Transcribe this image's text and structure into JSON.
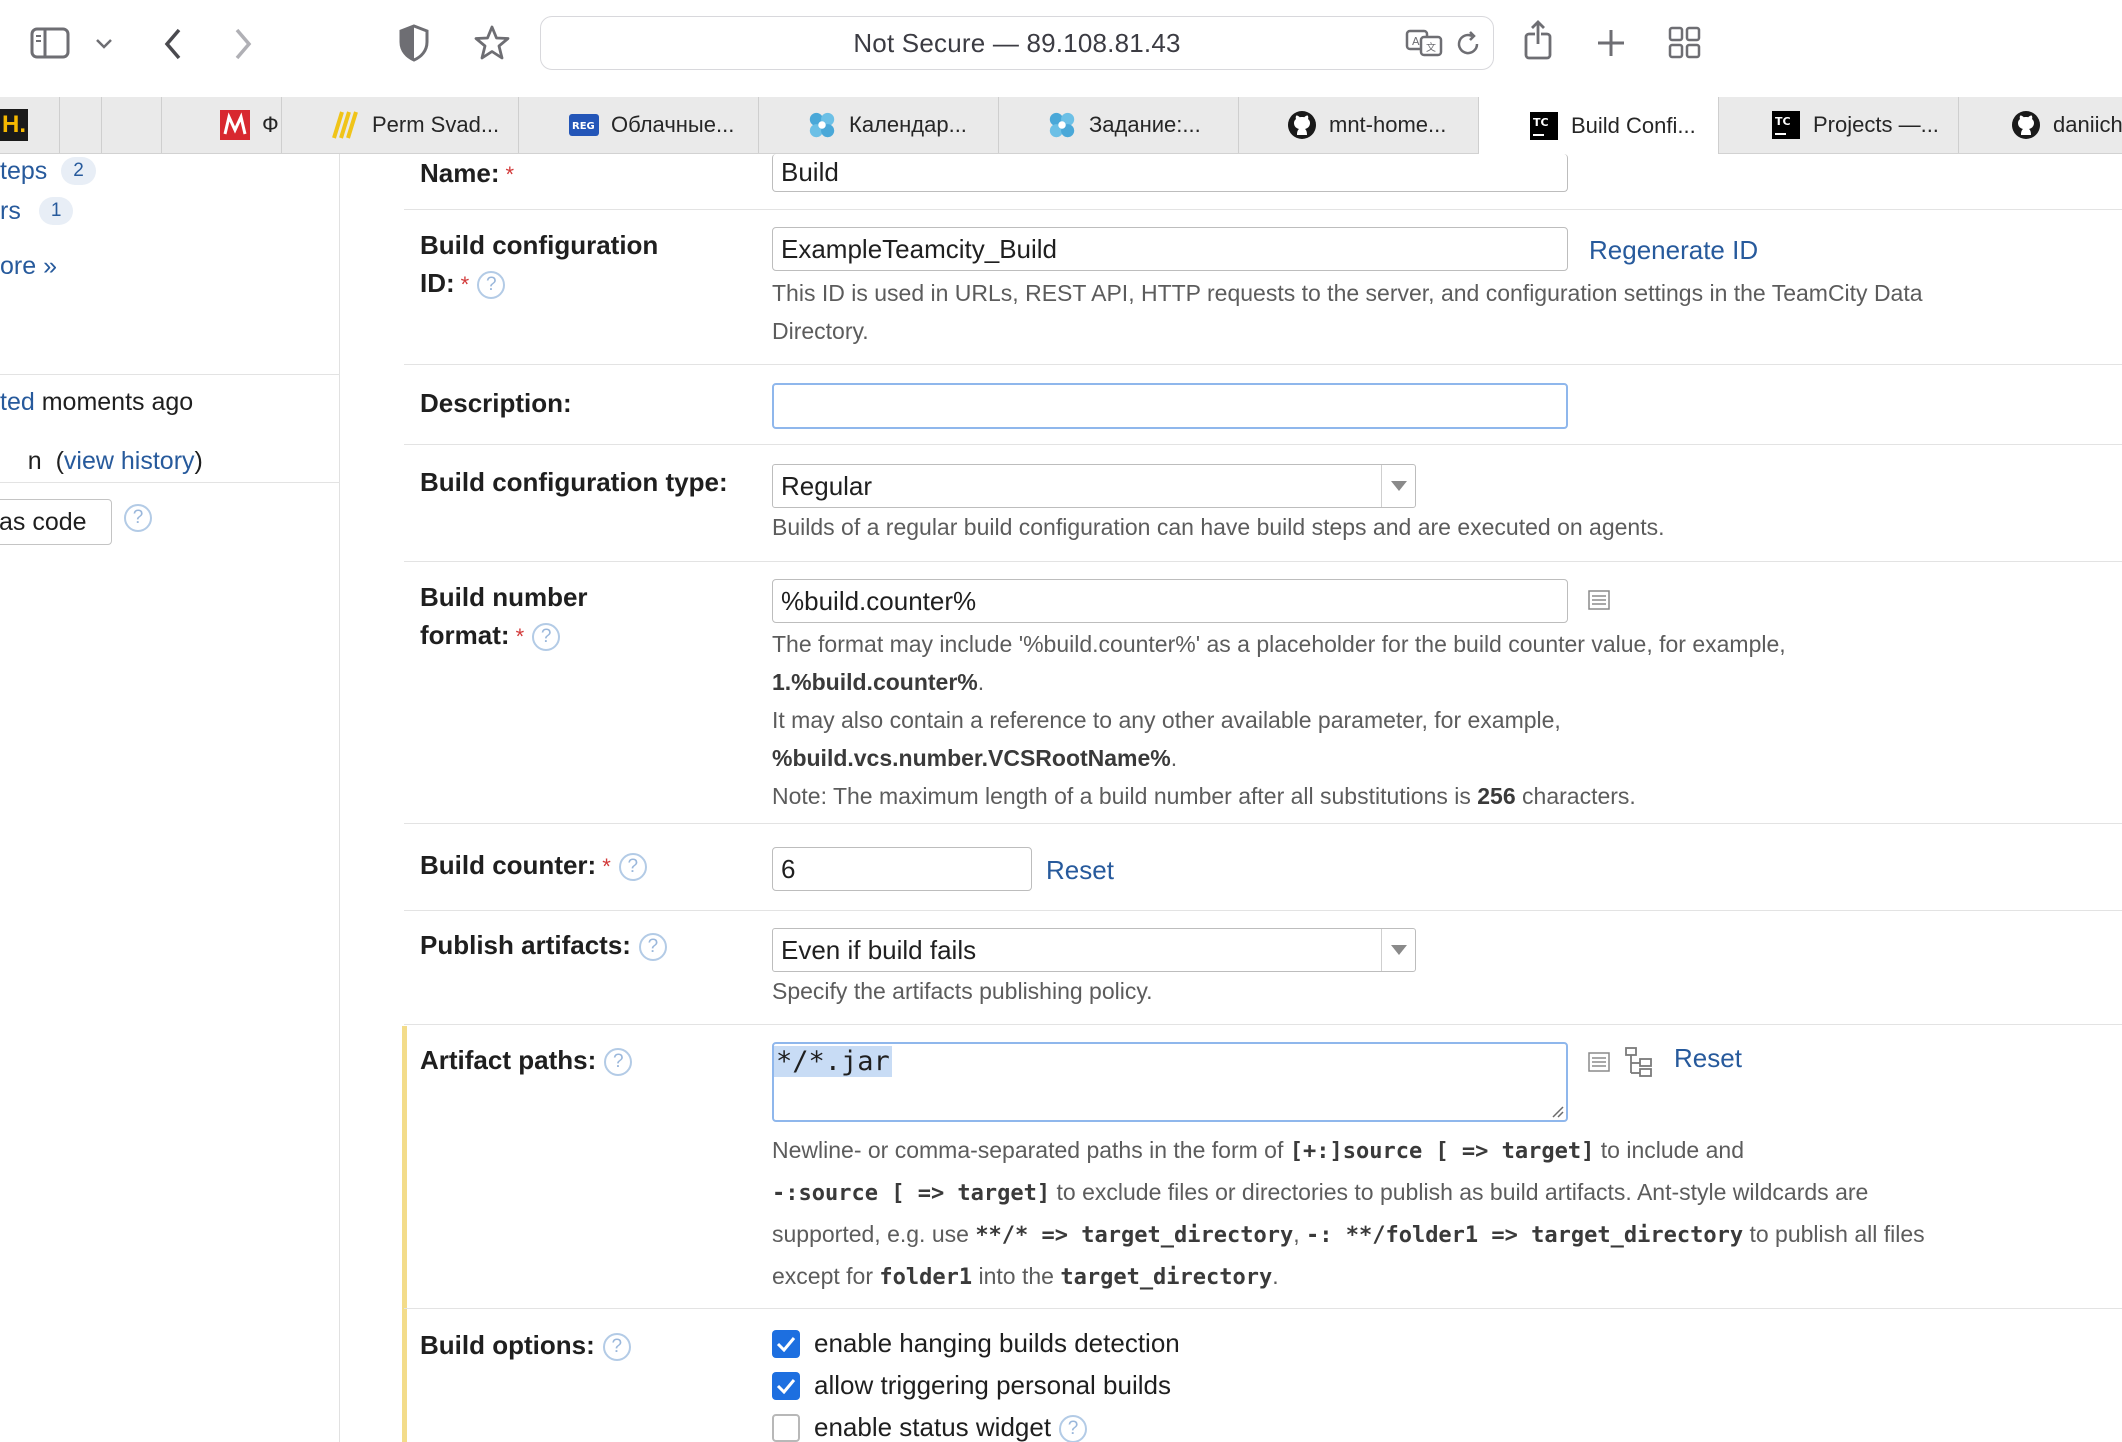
{
  "browser": {
    "address": "Not Secure — 89.108.81.43",
    "tabs": [
      {
        "label": "Ф",
        "icon": "red-m-icon"
      },
      {
        "label": "Perm Svad...",
        "icon": "yellow-lines-icon"
      },
      {
        "label": "Облачные...",
        "icon": "reg-icon"
      },
      {
        "label": "Календар...",
        "icon": "teams-icon"
      },
      {
        "label": "Задание:...",
        "icon": "teams-icon"
      },
      {
        "label": "mnt-home...",
        "icon": "github-icon"
      },
      {
        "label": "Build Confi...",
        "icon": "teamcity-icon"
      },
      {
        "label": "Projects —...",
        "icon": "teamcity-icon"
      },
      {
        "label": "daniich",
        "icon": "github-icon"
      }
    ],
    "first_tab_glyph": "H."
  },
  "sidebar": {
    "steps_label": "teps",
    "steps_count": "2",
    "triggers_label": "rs",
    "triggers_count": "1",
    "more_link": "ore »",
    "edited_link": "ted",
    "edited_text": " moments ago",
    "history_prefix": "n  (",
    "history_link": "view history",
    "history_suffix": ")",
    "as_code_button": "as code"
  },
  "form": {
    "name": {
      "label": "Name:",
      "value": "Build"
    },
    "config_id": {
      "label_line1": "Build configuration",
      "label_line2": "ID:",
      "value": "ExampleTeamcity_Build",
      "regenerate": "Regenerate ID",
      "note_line1": "This ID is used in URLs, REST API, HTTP requests to the server, and configuration settings in the TeamCity Data",
      "note_line2": "Directory."
    },
    "description": {
      "label": "Description:",
      "value": ""
    },
    "config_type": {
      "label": "Build configuration type:",
      "value": "Regular",
      "note": "Builds of a regular build configuration can have build steps and are executed on agents."
    },
    "number_format": {
      "label_line1": "Build number",
      "label_line2": "format:",
      "value": "%build.counter%",
      "note1": "The format may include '%build.counter%' as a placeholder for the build counter value, for example,",
      "note2_bold": "1.%build.counter%",
      "note2_rest": ".",
      "note3": "It may also contain a reference to any other available parameter, for example,",
      "note4_bold": "%build.vcs.number.VCSRootName%",
      "note4_rest": ".",
      "note5_pre": "Note: The maximum length of a build number after all substitutions is ",
      "note5_bold": "256",
      "note5_post": " characters."
    },
    "counter": {
      "label": "Build counter:",
      "value": "6",
      "reset": "Reset"
    },
    "publish": {
      "label": "Publish artifacts:",
      "value": "Even if build fails",
      "note": "Specify the artifacts publishing policy."
    },
    "artifacts": {
      "label": "Artifact paths:",
      "value": "*/*.jar",
      "reset": "Reset",
      "n1a": "Newline- or comma-separated paths in the form of ",
      "n1b": "[+:]source [ => target]",
      "n1c": " to include and",
      "n2a": "-:source [ => target]",
      "n2b": " to exclude files or directories to publish as build artifacts. Ant-style wildcards are",
      "n3a": "supported, e.g. use ",
      "n3b": "**/* => target_directory",
      "n3c": ", ",
      "n3d": "-: **/folder1 => target_directory",
      "n3e": " to publish all files",
      "n4a": "except for ",
      "n4b": "folder1",
      "n4c": " into the ",
      "n4d": "target_directory",
      "n4e": "."
    },
    "options": {
      "label": "Build options:",
      "items": [
        {
          "label": "enable hanging builds detection",
          "checked": true
        },
        {
          "label": "allow triggering personal builds",
          "checked": true
        },
        {
          "label": "enable status widget",
          "checked": false
        }
      ]
    },
    "required_mark": "*",
    "help_mark": "?"
  },
  "colors": {
    "link": "#275a9c",
    "checkbox": "#1d6fe0",
    "required": "#d23a3a"
  }
}
